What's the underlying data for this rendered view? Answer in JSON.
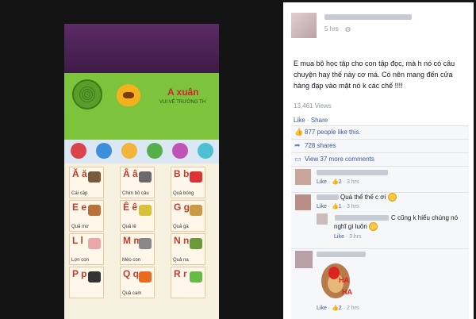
{
  "window": {
    "close_glyph": "✕"
  },
  "photo": {
    "title": "A xuân",
    "subtitle": "VUI VẺ TRƯỜNG TH",
    "cells": [
      {
        "letter": "Ă ă",
        "caption": "Cái cặp",
        "color": "#7a5a3a"
      },
      {
        "letter": "Â â",
        "caption": "Chim bồ câu",
        "color": "#6a6a6a"
      },
      {
        "letter": "B b",
        "caption": "Quả bóng",
        "color": "#d33"
      },
      {
        "letter": "E e",
        "caption": "Quả mơ",
        "color": "#b9723a"
      },
      {
        "letter": "Ê ê",
        "caption": "Quả lê",
        "color": "#d9c23a"
      },
      {
        "letter": "G g",
        "caption": "Quả gà",
        "color": "#c94"
      },
      {
        "letter": "L l",
        "caption": "Lợn con",
        "color": "#e9a9a9"
      },
      {
        "letter": "M m",
        "caption": "Mèo con",
        "color": "#888"
      },
      {
        "letter": "N n",
        "caption": "Quả na",
        "color": "#6a9a3a"
      },
      {
        "letter": "P p",
        "caption": "",
        "color": "#333"
      },
      {
        "letter": "Q q",
        "caption": "Quả cam",
        "color": "#e86b1f"
      },
      {
        "letter": "R r",
        "caption": "",
        "color": "#6b4"
      }
    ]
  },
  "post": {
    "time": "5 hrs",
    "text": "E mua bộ học tập cho con tập đọc, mà h nó có câu chuyện hay thế này cơ má. Có nên mang đến cửa hàng đạp vào mặt nó k các chế !!!!",
    "views": "13,461 Views",
    "like": "Like",
    "sep": "·",
    "share": "Share"
  },
  "ufi": {
    "likes": "877 people like this.",
    "shares": "728 shares",
    "more_comments": "View 37 more comments"
  },
  "comments": [
    {
      "text": "",
      "like": "Like",
      "likes": "2",
      "time": "3 hrs"
    },
    {
      "text": "Quá thể thế c ơi",
      "like": "Like",
      "likes": "1",
      "time": "3 hrs"
    },
    {
      "text": "C cũng k hiểu chúng nó nghĩ gì luôn",
      "like": "Like",
      "likes": "",
      "time": "3 hrs"
    },
    {
      "text": "",
      "like": "Like",
      "likes": "2",
      "time": "2 hrs",
      "sticker_text": "HA HA"
    }
  ],
  "icons": {
    "like": "thumbs-up-icon",
    "share": "share-arrow-icon",
    "comment": "comment-icon"
  }
}
